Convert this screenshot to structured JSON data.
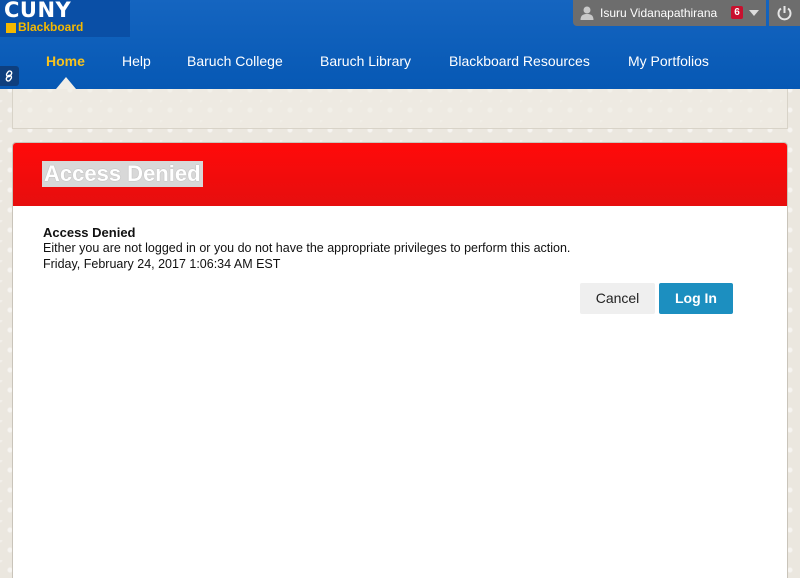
{
  "brand": {
    "logo_line1": "CUNY",
    "logo_line2": "Blackboard",
    "primary_color": "#0658b4",
    "accent_color": "#f8c31e"
  },
  "user": {
    "name": "Isuru Vidanapathirana",
    "notification_count": "6",
    "avatar_icon": "user-silhouette-icon",
    "menu_icon": "chevron-down-icon",
    "logout_icon": "power-icon"
  },
  "nav": {
    "tabs": [
      {
        "label": "Home",
        "active": true
      },
      {
        "label": "Help",
        "active": false
      },
      {
        "label": "Baruch College",
        "active": false
      },
      {
        "label": "Baruch Library",
        "active": false
      },
      {
        "label": "Blackboard Resources",
        "active": false
      },
      {
        "label": "My Portfolios",
        "active": false
      }
    ],
    "quick_link_icon": "link-icon"
  },
  "panel": {
    "title": "Access Denied",
    "header_color": "#f20b0b",
    "message_heading": "Access Denied",
    "message_body": "Either you are not logged in or you do not have the appropriate privileges to perform this action.",
    "timestamp": "Friday, February 24, 2017 1:06:34 AM EST",
    "cancel_label": "Cancel",
    "login_label": "Log In"
  }
}
